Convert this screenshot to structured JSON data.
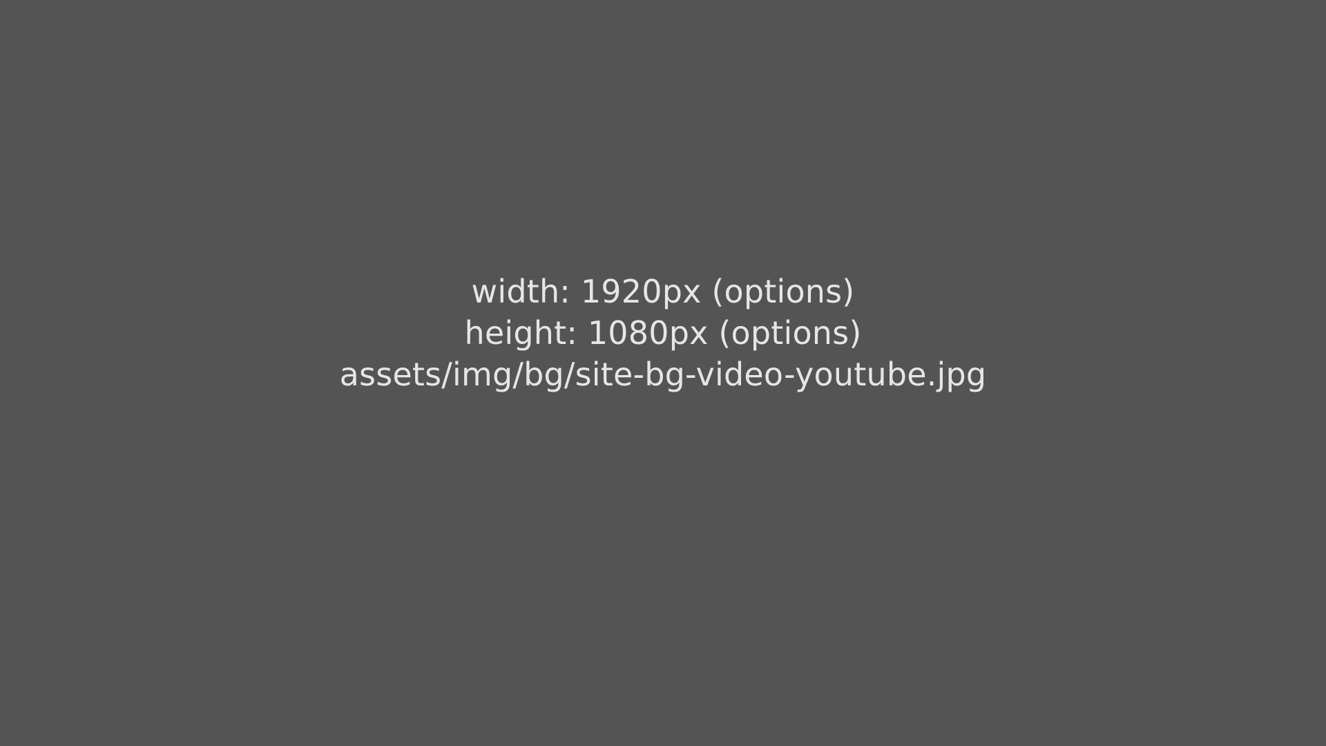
{
  "background_color": "#545454",
  "text_color": "#e6e6e6",
  "placeholder": {
    "width_line": "width: 1920px (options)",
    "height_line": "height: 1080px (options)",
    "path_line": "assets/img/bg/site-bg-video-youtube.jpg"
  }
}
